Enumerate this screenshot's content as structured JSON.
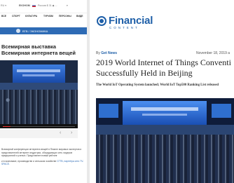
{
  "left_site": {
    "top_bar": {
      "lang": "RU ▾",
      "brand": "ЕКОНОМ",
      "currency": "Россия $ 31 ◆ ...",
      "date": "▾"
    },
    "nav_items": [
      "ВСЕ",
      "СПОРТ",
      "КУЛЬТУРА",
      "ТУРИЗМ",
      "ПЕРСОНЫ",
      "ВИДЕ"
    ],
    "section_label": "ВТВ / ЭКОНОМИКА",
    "headline": "Всемирная выставка Всемирная интернета вещей",
    "prev_label": "‹",
    "next_label": "›",
    "body_paragraphs": [
      "Всемирной конференции интернета вещей в Пекине мировых экспертов и представителей интернет индустрии, обсуждающих сеть лидеров предприятий и ученых. Представлен новый рейтинг",
      "и в экономике, производстве и сельском хозяйстве"
    ],
    "body_link": "СГТВ, партнёра сети TV-SPACE."
  },
  "right_site": {
    "logo_main": "Financial",
    "logo_sub": "CONTENT",
    "byline_prefix": "By",
    "byline_source": "Get News",
    "date": "November 18, 2019 a",
    "headline": "2019 World Internet of Things Conventi Successfully Held in Beijing",
    "subheadline": "The World IoT Operating System launched; World IoT Top500 Ranking List released"
  },
  "video_player": {
    "progress_fraction": 0.1
  },
  "colors": {
    "fc_blue": "#1e5fa8",
    "section_blue": "#2e6bb5"
  }
}
